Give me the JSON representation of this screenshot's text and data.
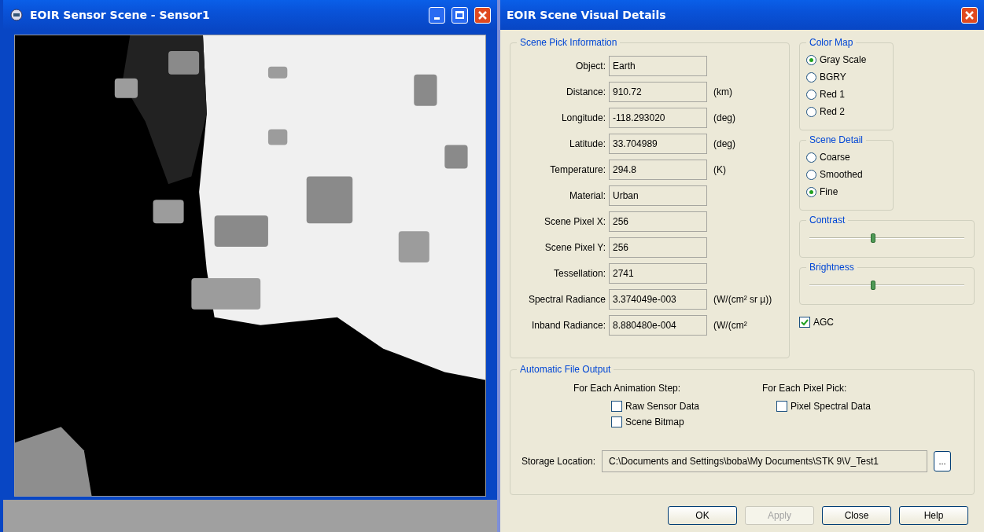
{
  "sensor_window": {
    "title": "EOIR Sensor Scene - Sensor1"
  },
  "dialog": {
    "title": "EOIR Scene Visual Details",
    "pick_info": {
      "title": "Scene Pick Information",
      "rows": [
        {
          "label": "Object:",
          "value": "Earth"
        },
        {
          "label": "Distance:",
          "value": "910.72",
          "unit": "(km)"
        },
        {
          "label": "Longitude:",
          "value": "-118.293020",
          "unit": "(deg)"
        },
        {
          "label": "Latitude:",
          "value": "33.704989",
          "unit": "(deg)"
        },
        {
          "label": "Temperature:",
          "value": "294.8",
          "unit": "(K)"
        },
        {
          "label": "Material:",
          "value": "Urban"
        },
        {
          "label": "Scene Pixel X:",
          "value": "256"
        },
        {
          "label": "Scene Pixel Y:",
          "value": "256"
        },
        {
          "label": "Tessellation:",
          "value": "2741"
        },
        {
          "label": "Spectral Radiance",
          "value": "3.374049e-003",
          "unit": "(W/(cm² sr µ))"
        },
        {
          "label": "Inband Radiance:",
          "value": "8.880480e-004",
          "unit": "(W/(cm²"
        }
      ]
    },
    "color_map": {
      "title": "Color Map",
      "options": [
        {
          "label": "Gray Scale",
          "selected": true
        },
        {
          "label": "BGRY",
          "selected": false
        },
        {
          "label": "Red 1",
          "selected": false
        },
        {
          "label": "Red 2",
          "selected": false
        }
      ]
    },
    "scene_detail": {
      "title": "Scene Detail",
      "options": [
        {
          "label": "Coarse",
          "selected": false
        },
        {
          "label": "Smoothed",
          "selected": false
        },
        {
          "label": "Fine",
          "selected": true
        }
      ]
    },
    "contrast": {
      "title": "Contrast",
      "level": 0.41
    },
    "brightness": {
      "title": "Brightness",
      "level": 0.41
    },
    "agc": {
      "label": "AGC",
      "checked": true
    },
    "file_output": {
      "title": "Automatic File Output",
      "columns": [
        {
          "heading": "For Each Animation Step:",
          "options": [
            {
              "label": "Raw Sensor Data",
              "checked": false
            },
            {
              "label": "Scene Bitmap",
              "checked": false
            }
          ]
        },
        {
          "heading": "For Each Pixel Pick:",
          "options": [
            {
              "label": "Pixel Spectral Data",
              "checked": false
            }
          ]
        }
      ],
      "storage": {
        "label": "Storage Location:",
        "value": "C:\\Documents and Settings\\boba\\My Documents\\STK 9\\V_Test1"
      },
      "browse": "..."
    },
    "buttons": [
      {
        "label": "OK",
        "disabled": false
      },
      {
        "label": "Apply",
        "disabled": true
      },
      {
        "label": "Close",
        "disabled": false
      },
      {
        "label": "Help",
        "disabled": false
      }
    ]
  }
}
